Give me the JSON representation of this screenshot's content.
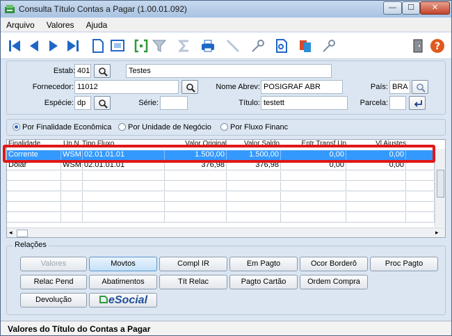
{
  "window": {
    "title": "Consulta Título Contas a Pagar (1.00.01.092)",
    "buttons": {
      "minimize": "—",
      "maximize": "☐",
      "close": "✕"
    }
  },
  "menu": [
    "Arquivo",
    "Valores",
    "Ajuda"
  ],
  "toolbar": {
    "icons": [
      "first-icon",
      "previous-icon",
      "next-icon",
      "last-icon",
      "new-document-icon",
      "preview-icon",
      "goto-icon",
      "filter-icon",
      "sum-icon",
      "print-icon",
      "line-icon",
      "key-icon",
      "zoom-document-icon",
      "copy-icon",
      "key-icon",
      "exit-icon",
      "help-icon"
    ]
  },
  "header": {
    "estab_label": "Estab:",
    "estab_value": "401",
    "estab_desc": "Testes",
    "fornecedor_label": "Fornecedor:",
    "fornecedor_value": "11012",
    "nome_abrev_label": "Nome Abrev:",
    "nome_abrev_value": "POSIGRAF ABR",
    "pais_label": "País:",
    "pais_value": "BRA",
    "especie_label": "Espécie:",
    "especie_value": "dp",
    "serie_label": "Série:",
    "serie_value": "",
    "titulo_label": "Título:",
    "titulo_value": "testett",
    "parcela_label": "Parcela:",
    "parcela_value": ""
  },
  "radio": {
    "options": [
      "Por Finalidade Econômica",
      "Por Unidade de Negócio",
      "Por Fluxo Financ"
    ],
    "selected": 0
  },
  "grid": {
    "columns": [
      "Finalidade",
      "Un N",
      "Tipo Fluxo",
      "Valor Original",
      "Valor Saldo",
      "Entr Transf Un",
      "Vl Ajustes"
    ],
    "rows": [
      [
        "Corrente",
        "WSM",
        "02.01.01.01",
        "1.500,00",
        "1.500,00",
        "0,00",
        "0,00"
      ],
      [
        "Dolar",
        "WSM",
        "02.01.01.01",
        "376,98",
        "376,98",
        "0,00",
        "0,00"
      ]
    ],
    "selected_row": 0
  },
  "relacoes": {
    "legend": "Relações",
    "row1": [
      "Valores",
      "Movtos",
      "Compl IR",
      "Em Pagto",
      "Ocor Borderô",
      "Proc Pagto"
    ],
    "row2": [
      "Relac Pend",
      "Abatimentos",
      "Tít Relac",
      "Pagto Cartão",
      "Ordem Compra"
    ],
    "row3": [
      "Devolução",
      "eSocial"
    ]
  },
  "status": "Valores do Título do Contas a Pagar",
  "colors": {
    "selection": "#3399ff",
    "highlight_border": "#e01818",
    "toolbar_blue": "#1f67c7"
  }
}
